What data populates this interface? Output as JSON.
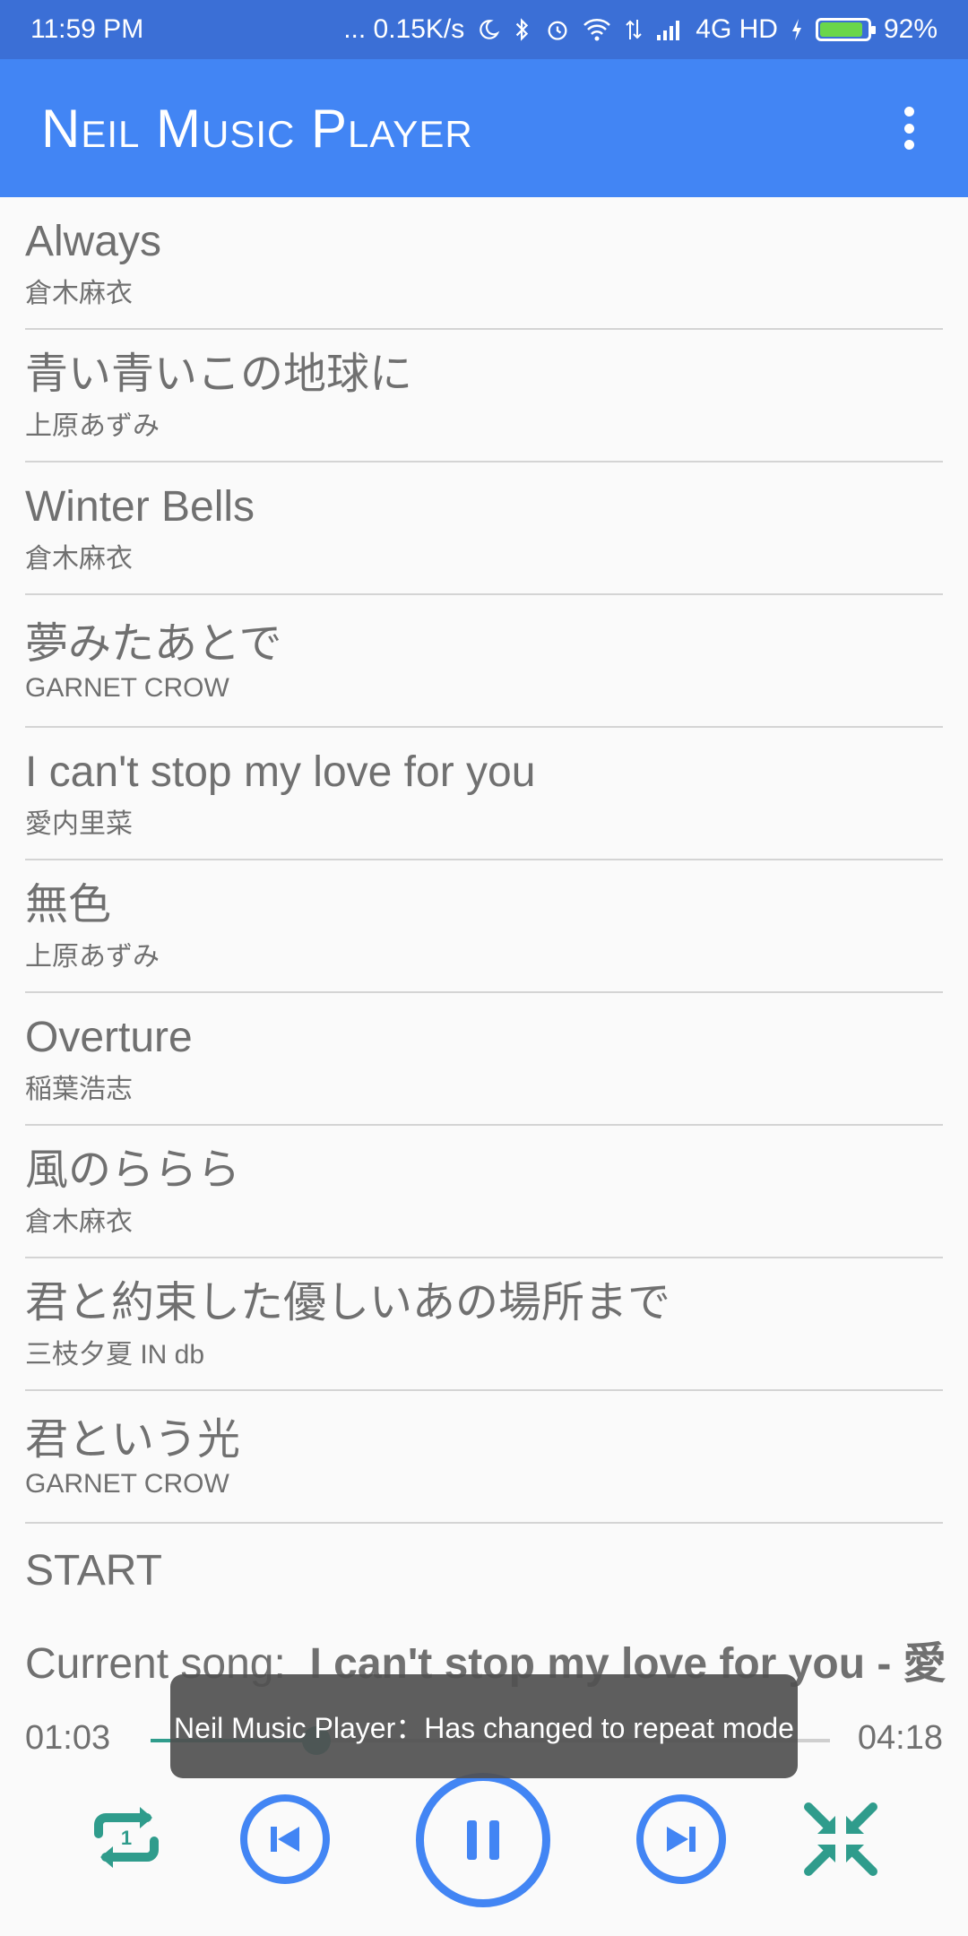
{
  "status_bar": {
    "time": "11:59 PM",
    "net_speed": "... 0.15K/s",
    "network": "4G HD",
    "battery_percent": "92%",
    "battery_level": 0.92,
    "icons": [
      "moon-icon",
      "bluetooth-icon",
      "alarm-icon",
      "wifi-icon",
      "data-arrows-icon",
      "signal-icon",
      "charging-icon",
      "battery-icon"
    ]
  },
  "app_bar": {
    "title": "Neil Music Player",
    "menu_icon": "overflow-menu-icon"
  },
  "songs": [
    {
      "title": "Always",
      "artist": "倉木麻衣"
    },
    {
      "title": "青い青いこの地球に",
      "artist": "上原あずみ"
    },
    {
      "title": "Winter Bells",
      "artist": "倉木麻衣"
    },
    {
      "title": "夢みたあとで",
      "artist": "GARNET CROW"
    },
    {
      "title": "I can't stop my love for you",
      "artist": "愛内里菜"
    },
    {
      "title": "無色",
      "artist": "上原あずみ"
    },
    {
      "title": "Overture",
      "artist": "稲葉浩志"
    },
    {
      "title": "風のららら",
      "artist": "倉木麻衣"
    },
    {
      "title": "君と約束した優しいあの場所まで",
      "artist": "三枝夕夏 IN db"
    },
    {
      "title": "君という光",
      "artist": "GARNET CROW"
    }
  ],
  "start_label": "START",
  "current_song": {
    "prefix": "Current song:",
    "value": "I can't stop my love for you - 愛"
  },
  "player": {
    "elapsed": "01:03",
    "duration": "04:18",
    "progress": 0.244,
    "accent_color": "#4285f4",
    "teal_color": "#2f9c8c",
    "repeat_badge": "1"
  },
  "toast": {
    "message": "Neil Music Player：Has changed to repeat mode"
  }
}
